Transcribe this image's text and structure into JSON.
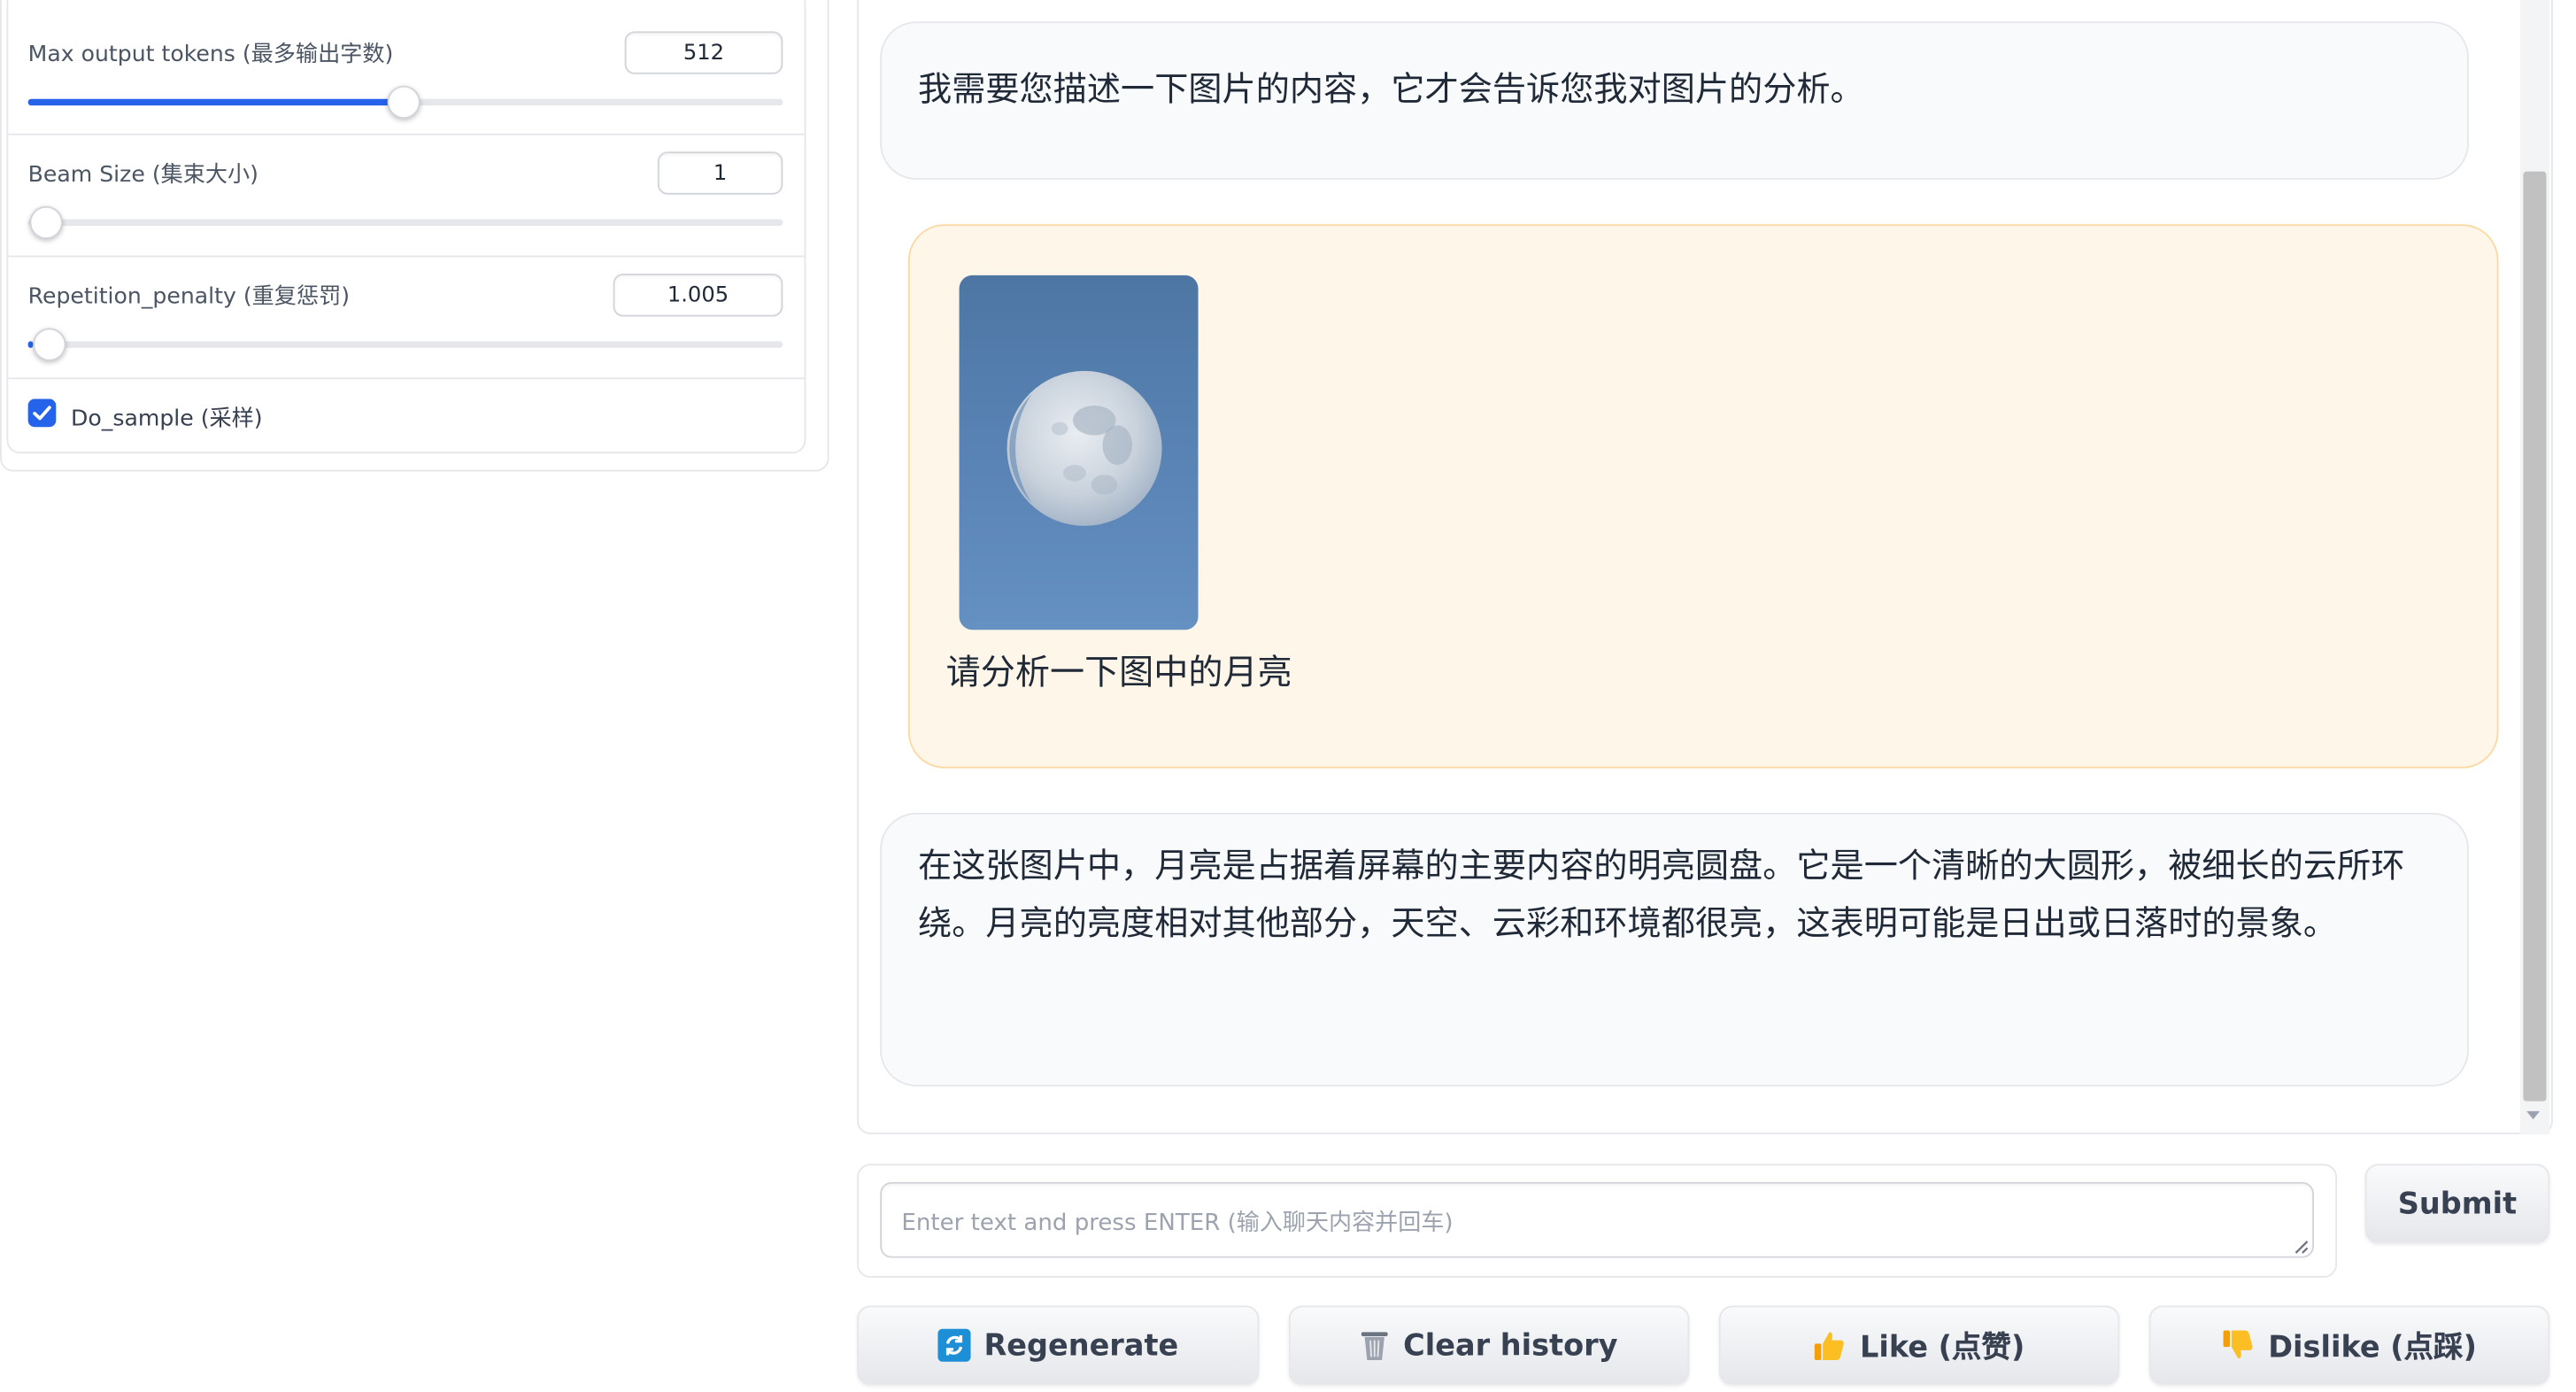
{
  "settings": {
    "max_tokens": {
      "label": "Max output tokens (最多输出字数)",
      "value": "512",
      "level_fraction": 0.5
    },
    "beam_size": {
      "label": "Beam Size (集束大小)",
      "value": "1",
      "level_fraction": 0.0
    },
    "repetition_penalty": {
      "label": "Repetition_penalty (重复惩罚)",
      "value": "1.005",
      "level_fraction": 0.0
    },
    "do_sample": {
      "label": "Do_sample (采样)",
      "checked": true
    }
  },
  "chat": {
    "messages": [
      {
        "role": "bot",
        "text": "我需要您描述一下图片的内容，它才会告诉您我对图片的分析。"
      },
      {
        "role": "user",
        "has_image": true,
        "image_subject": "moon",
        "text": "请分析一下图中的月亮"
      },
      {
        "role": "bot",
        "text": "在这张图片中，月亮是占据着屏幕的主要内容的明亮圆盘。它是一个清晰的大圆形，被细长的云所环绕。月亮的亮度相对其他部分，天空、云彩和环境都很亮，这表明可能是日出或日落时的景象。"
      }
    ]
  },
  "input": {
    "placeholder": "Enter text and press ENTER (输入聊天内容并回车)",
    "submit_label": "Submit"
  },
  "buttons": {
    "regenerate": "Regenerate",
    "clear_history": "Clear history",
    "like": "Like (点赞)",
    "dislike": "Dislike (点踩)"
  },
  "colors": {
    "accent": "#2563eb",
    "user_bubble": "#fef6e9",
    "user_bubble_border": "#fbd9a3",
    "bot_bubble": "#f9fafb"
  }
}
